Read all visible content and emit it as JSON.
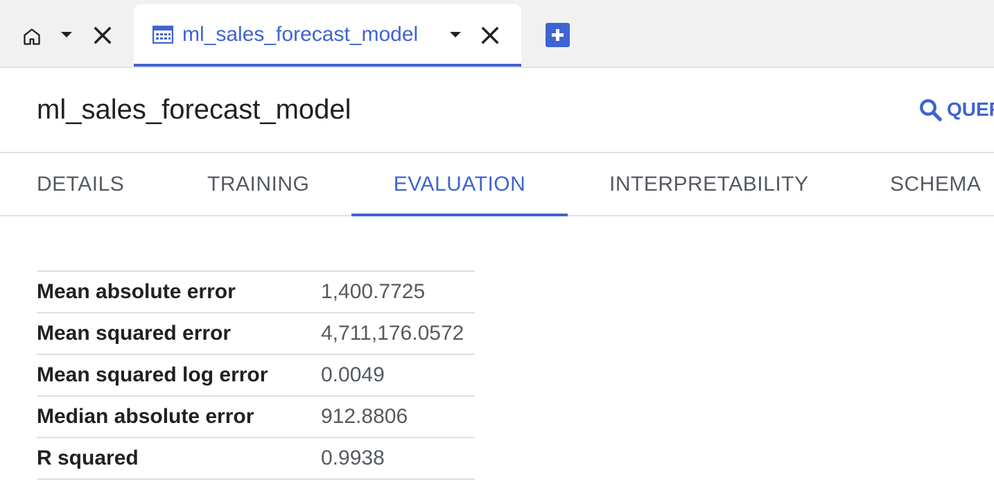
{
  "tabs": {
    "home": {
      "icon": "home-icon"
    },
    "active": {
      "icon": "table-icon",
      "label": "ml_sales_forecast_model"
    },
    "new_tab_icon": "plus-icon"
  },
  "header": {
    "title": "ml_sales_forecast_model",
    "query_label": "QUERY",
    "query_icon": "search-icon"
  },
  "nav_tabs": [
    {
      "label": "DETAILS",
      "selected": false
    },
    {
      "label": "TRAINING",
      "selected": false
    },
    {
      "label": "EVALUATION",
      "selected": true
    },
    {
      "label": "INTERPRETABILITY",
      "selected": false
    },
    {
      "label": "SCHEMA",
      "selected": false
    }
  ],
  "metrics": [
    {
      "name": "Mean absolute error",
      "value": "1,400.7725"
    },
    {
      "name": "Mean squared error",
      "value": "4,711,176.0572"
    },
    {
      "name": "Mean squared log error",
      "value": "0.0049"
    },
    {
      "name": "Median absolute error",
      "value": "912.8806"
    },
    {
      "name": "R squared",
      "value": "0.9938"
    }
  ],
  "colors": {
    "accent": "#3f64d1",
    "text": "#202124",
    "muted_text": "#555a60",
    "divider": "#e0e0e0",
    "tabstrip_bg": "#f1f1f1"
  }
}
